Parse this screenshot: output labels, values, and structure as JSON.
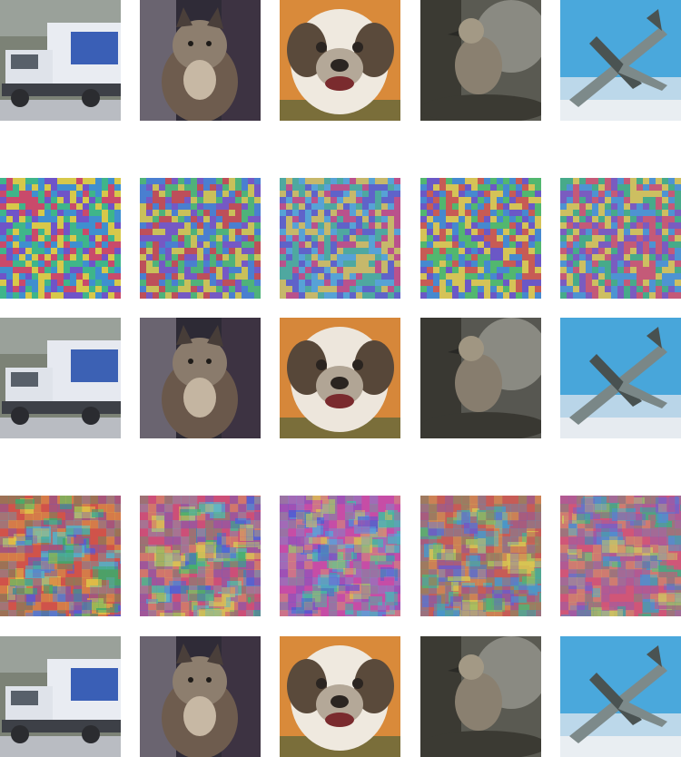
{
  "figure": {
    "rows": [
      {
        "role": "original",
        "tiles": [
          {
            "subject": "truck",
            "palette": [
              "#e9ecf2",
              "#8f98a6",
              "#3a5fb6",
              "#2b2c30",
              "#6d7365"
            ]
          },
          {
            "subject": "cat",
            "palette": [
              "#6e5c4e",
              "#c7b8a4",
              "#2f2b37",
              "#8d7e6e",
              "#4a3f3a"
            ]
          },
          {
            "subject": "dog",
            "palette": [
              "#d98a3a",
              "#efe9df",
              "#5a4a3b",
              "#b4a898",
              "#2b2521"
            ]
          },
          {
            "subject": "bird",
            "palette": [
              "#5a5a52",
              "#8a8070",
              "#3b3a33",
              "#a39985",
              "#2a2a26"
            ]
          },
          {
            "subject": "airplane",
            "palette": [
              "#4aa8dc",
              "#e9eef2",
              "#7d8a8a",
              "#4a5352",
              "#bcd8ea"
            ]
          }
        ]
      },
      {
        "role": "noise",
        "tiles": [
          {
            "subject": "noise",
            "palette": [
              "#c94a6b",
              "#3fb58a",
              "#6f54c8",
              "#d7c84a",
              "#3f8fcf"
            ]
          },
          {
            "subject": "noise",
            "palette": [
              "#bd4f5a",
              "#4fb27a",
              "#7559c4",
              "#c9c05a",
              "#4a7fd0"
            ]
          },
          {
            "subject": "noise",
            "palette": [
              "#b9528c",
              "#4fa8a0",
              "#5f63c9",
              "#c6b86b",
              "#57a2d6"
            ]
          },
          {
            "subject": "noise",
            "palette": [
              "#c75b55",
              "#52b76f",
              "#6b58c6",
              "#d5c357",
              "#4689cf"
            ]
          },
          {
            "subject": "noise",
            "palette": [
              "#c45a78",
              "#47aa8a",
              "#7a5cc0",
              "#cdbf61",
              "#4e93d2"
            ]
          }
        ]
      },
      {
        "role": "reconstruction",
        "tiles": [
          {
            "subject": "truck",
            "palette": [
              "#e6e9f0",
              "#8b94a3",
              "#3c61b4",
              "#2a2b30",
              "#6a7062"
            ]
          },
          {
            "subject": "cat",
            "palette": [
              "#6a584b",
              "#c4b5a1",
              "#2d2a35",
              "#8a7b6c",
              "#473d38"
            ]
          },
          {
            "subject": "dog",
            "palette": [
              "#d6873a",
              "#ede6dc",
              "#574739",
              "#b1a595",
              "#2a2420"
            ]
          },
          {
            "subject": "bird",
            "palette": [
              "#575751",
              "#877d6e",
              "#393832",
              "#a09682",
              "#282825"
            ]
          },
          {
            "subject": "airplane",
            "palette": [
              "#48a6da",
              "#e6ebf0",
              "#7a8787",
              "#485150",
              "#b9d5e8"
            ]
          }
        ]
      },
      {
        "role": "perturbation",
        "tiles": [
          {
            "subject": "perturbation",
            "palette": [
              "#d0534a",
              "#3fa86b",
              "#5d59d1",
              "#e0c647",
              "#53b3c8"
            ]
          },
          {
            "subject": "perturbation",
            "palette": [
              "#cc4f78",
              "#48b06d",
              "#4d63d6",
              "#d9bf57",
              "#62b6c4"
            ]
          },
          {
            "subject": "perturbation",
            "palette": [
              "#c74ea6",
              "#47b8a0",
              "#5559d2",
              "#dab957",
              "#5ea0d7"
            ]
          },
          {
            "subject": "perturbation",
            "palette": [
              "#c75d57",
              "#55b274",
              "#6d5bc9",
              "#d7c654",
              "#4b98c8"
            ]
          },
          {
            "subject": "perturbation",
            "palette": [
              "#d05679",
              "#44aa84",
              "#7a60c4",
              "#cfbf63",
              "#4f90cf"
            ]
          }
        ]
      },
      {
        "role": "adversarial",
        "tiles": [
          {
            "subject": "truck",
            "palette": [
              "#e9ecf2",
              "#8f98a6",
              "#3a5fb6",
              "#2b2c30",
              "#6d7365"
            ]
          },
          {
            "subject": "cat",
            "palette": [
              "#6e5c4e",
              "#c7b8a4",
              "#2f2b37",
              "#8d7e6e",
              "#4a3f3a"
            ]
          },
          {
            "subject": "dog",
            "palette": [
              "#d98a3a",
              "#efe9df",
              "#5a4a3b",
              "#b4a898",
              "#2b2521"
            ]
          },
          {
            "subject": "bird",
            "palette": [
              "#5a5a52",
              "#8a8070",
              "#3b3a33",
              "#a39985",
              "#2a2a26"
            ]
          },
          {
            "subject": "airplane",
            "palette": [
              "#4aa8dc",
              "#e9eef2",
              "#7d8a8a",
              "#4a5352",
              "#bcd8ea"
            ]
          }
        ]
      }
    ]
  }
}
